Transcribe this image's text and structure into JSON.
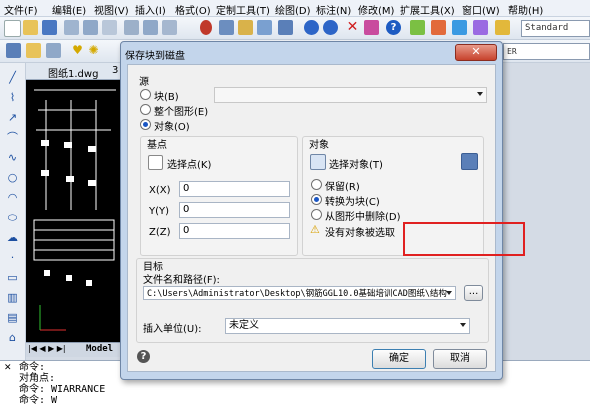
{
  "app": {
    "menu": [
      "文件(F)",
      "编辑(E)",
      "视图(V)",
      "插入(I)",
      "格式(O)",
      "定制工具(T)",
      "绘图(D)",
      "标注(N)",
      "修改(M)",
      "扩展工具(X)",
      "窗口(W)",
      "帮助(H)"
    ],
    "text_style": "Standard",
    "tab_label": "图纸1.dwg",
    "tab_label2": "3",
    "model_tab": "Model"
  },
  "command": {
    "lines": [
      "命令:",
      "对角点:",
      "命令:  WIARRANCE",
      "命令:  W"
    ]
  },
  "dialog": {
    "title": "保存块到磁盘",
    "close_label": "✕",
    "source": {
      "label": "源",
      "options": [
        {
          "label": "块(B)",
          "selected": false
        },
        {
          "label": "整个图形(E)",
          "selected": false
        },
        {
          "label": "对象(O)",
          "selected": true
        }
      ],
      "block_select": ""
    },
    "base_point": {
      "label": "基点",
      "pick_label": "选择点(K)",
      "x_label": "X(X)",
      "y_label": "Y(Y)",
      "z_label": "Z(Z)",
      "x": "0",
      "y": "0",
      "z": "0"
    },
    "objects": {
      "label": "对象",
      "select_label": "选择对象(T)",
      "options": [
        {
          "label": "保留(R)",
          "selected": false
        },
        {
          "label": "转换为块(C)",
          "selected": true
        },
        {
          "label": "从图形中删除(D)",
          "selected": false
        }
      ],
      "warning": "没有对象被选取"
    },
    "target": {
      "label": "目标",
      "path_label": "文件名和路径(F):",
      "path_value": "C:\\Users\\Administrator\\Desktop\\钢筋GGL10.0基础培训CAD图纸\\结构",
      "browse_label": "...",
      "units_label": "插入单位(U):",
      "units_value": "未定义"
    },
    "ok_label": "确定",
    "cancel_label": "取消",
    "help_label": "?"
  },
  "colors": {
    "highlight": "#e02020",
    "dialog_frame": "#c3d5eb"
  }
}
